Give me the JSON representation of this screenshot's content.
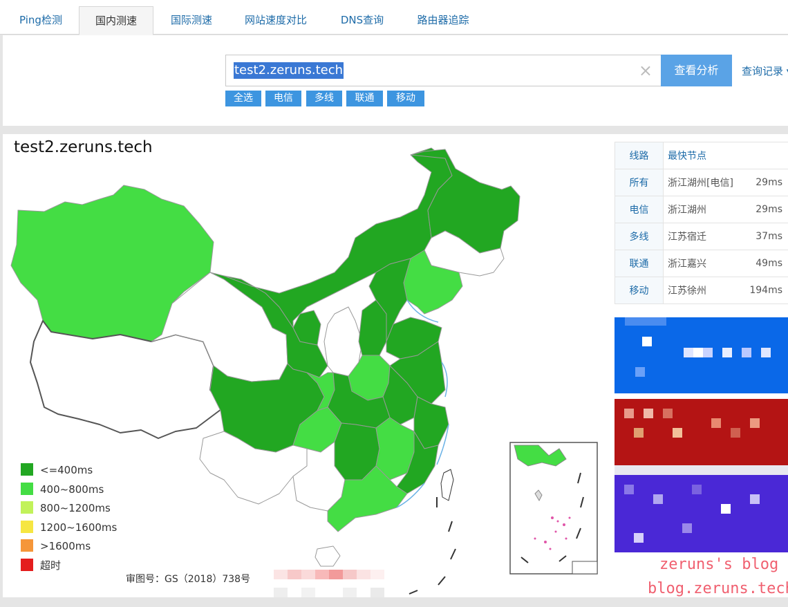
{
  "tabs": [
    {
      "label": "Ping检测",
      "active": false
    },
    {
      "label": "国内测速",
      "active": true
    },
    {
      "label": "国际测速",
      "active": false
    },
    {
      "label": "网站速度对比",
      "active": false
    },
    {
      "label": "DNS查询",
      "active": false
    },
    {
      "label": "路由器追踪",
      "active": false
    }
  ],
  "search": {
    "value": "test2.zeruns.tech",
    "clear_icon": "×",
    "analyze_label": "查看分析",
    "history_label": "查询记录 ▾"
  },
  "filters": [
    "全选",
    "电信",
    "多线",
    "联通",
    "移动"
  ],
  "result": {
    "title": "test2.zeruns.tech",
    "table": {
      "headers": [
        "线路",
        "最快节点"
      ],
      "rows": [
        {
          "line": "所有",
          "node": "浙江湖州[电信]",
          "ms": "29ms"
        },
        {
          "line": "电信",
          "node": "浙江湖州",
          "ms": "29ms"
        },
        {
          "line": "多线",
          "node": "江苏宿迁",
          "ms": "37ms"
        },
        {
          "line": "联通",
          "node": "浙江嘉兴",
          "ms": "49ms"
        },
        {
          "line": "移动",
          "node": "江苏徐州",
          "ms": "194ms"
        }
      ]
    },
    "legend": [
      {
        "label": "<=400ms",
        "color": "#22a722"
      },
      {
        "label": "400~800ms",
        "color": "#44dd44"
      },
      {
        "label": "800~1200ms",
        "color": "#c2f25a"
      },
      {
        "label": "1200~1600ms",
        "color": "#f6e642"
      },
      {
        "label": ">1600ms",
        "color": "#f5963a"
      },
      {
        "label": "超时",
        "color": "#e41d1d"
      }
    ],
    "approval_number": "审图号：GS（2018）738号"
  },
  "watermark": {
    "line1": "zeruns's blog",
    "line2": "blog.zeruns.tech"
  },
  "colors": {
    "fast": "#22a722",
    "medium": "#44dd44",
    "none": "#ffffff",
    "link": "#1d6ba8",
    "button": "#5aa3e6",
    "filter": "#3d95e0"
  }
}
